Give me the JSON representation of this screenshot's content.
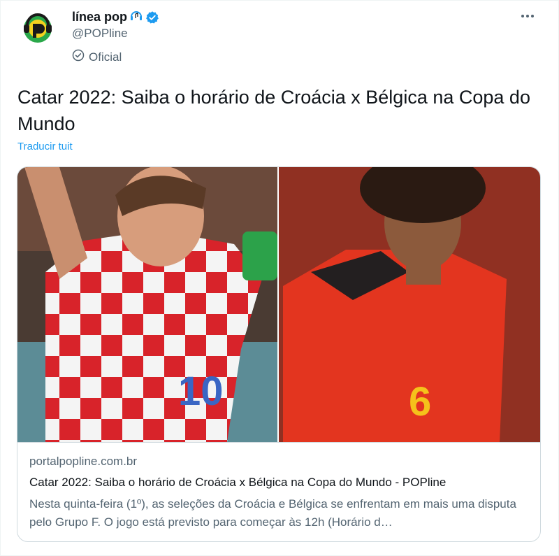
{
  "account": {
    "display_name": "línea pop",
    "handle": "@POPline",
    "label": "Oficial"
  },
  "tweet": {
    "text": "Catar 2022: Saiba o horário de Croácia x Bélgica na Copa do Mundo",
    "translate_link": "Traducir tuit"
  },
  "link_card": {
    "domain": "portalpopline.com.br",
    "title": "Catar 2022: Saiba o horário de Croácia x Bélgica na Copa do Mundo - POPline",
    "description": "Nesta quinta-feira (1º), as seleções da Croácia e Bélgica se enfrentam em mais uma disputa pelo Grupo F. O jogo está previsto para começar às 12h (Horário d…",
    "image_left_shirt_number": "10",
    "image_right_shirt_number": "6"
  },
  "icons": {
    "verified": "verified-badge-icon",
    "music": "headphones-music-icon",
    "official": "official-check-icon",
    "more": "more-options-icon"
  },
  "colors": {
    "link_blue": "#1d9bf0",
    "secondary_text": "#536471",
    "primary_text": "#0f1419",
    "border": "#cfd9de"
  }
}
